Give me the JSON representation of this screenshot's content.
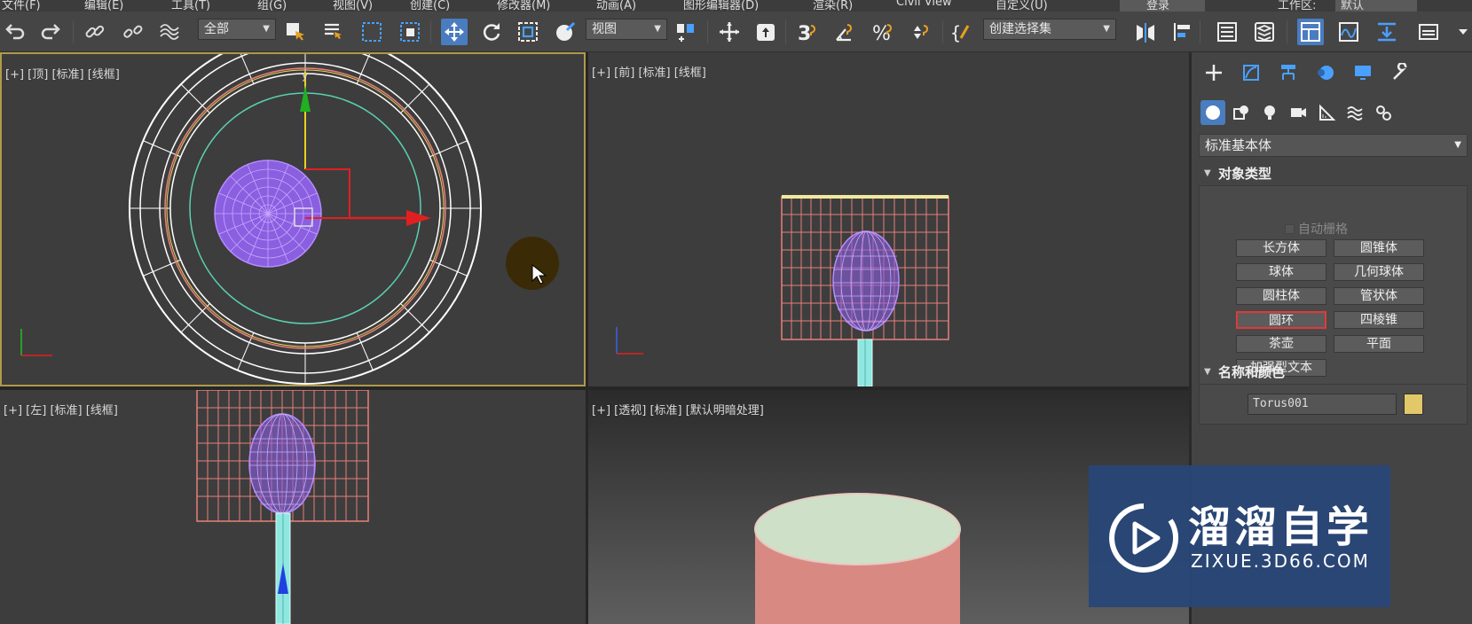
{
  "menubar": {
    "items": [
      "文件(F)",
      "编辑(E)",
      "工具(T)",
      "组(G)",
      "视图(V)",
      "创建(C)",
      "修改器(M)",
      "动画(A)",
      "图形编辑器(D)",
      "渲染(R)",
      "Civil View",
      "自定义(U)"
    ],
    "login_label": "登录",
    "workspace_label": "工作区:",
    "workspace_value": "默认"
  },
  "toolbar": {
    "selection_filter": "全部",
    "ref_coord": "视图",
    "named_selection": "创建选择集",
    "snap_label": "3",
    "icons": [
      "undo-icon",
      "redo-icon",
      "link-icon",
      "unlink-icon",
      "bind-spacewarp-icon",
      "select-object-icon",
      "select-by-name-icon",
      "rect-region-icon",
      "window-crossing-icon",
      "move-icon",
      "rotate-icon",
      "scale-icon",
      "placement-icon",
      "pivot-icon",
      "manipulate-icon",
      "snap-toggle-icon",
      "angle-snap-icon",
      "percent-snap-icon",
      "spinner-snap-icon",
      "edit-named-sets-icon",
      "mirror-icon",
      "align-icon",
      "layer-explorer-icon",
      "scene-explorer-icon",
      "ribbon-icon",
      "curve-editor-icon",
      "render-setup-icon",
      "rendered-frame-icon"
    ]
  },
  "viewports": {
    "top": {
      "label": "[+] [顶] [标准] [线框]"
    },
    "front": {
      "label": "[+] [前] [标准] [线框]"
    },
    "left": {
      "label": "[+] [左] [标准] [线框]"
    },
    "perspective": {
      "label": "[+] [透视] [标准] [默认明暗处理]"
    }
  },
  "command_panel": {
    "tabs": [
      "create-tab-icon",
      "modify-tab-icon",
      "hierarchy-tab-icon",
      "motion-tab-icon",
      "display-tab-icon",
      "utilities-tab-icon"
    ],
    "subcategories": [
      "geometry-icon",
      "shapes-icon",
      "lights-icon",
      "cameras-icon",
      "helpers-icon",
      "spacewarps-icon",
      "systems-icon"
    ],
    "category": "标准基本体",
    "object_type": {
      "title": "对象类型",
      "autogrid_label": "自动栅格",
      "buttons": [
        "长方体",
        "圆锥体",
        "球体",
        "几何球体",
        "圆柱体",
        "管状体",
        "圆环",
        "四棱锥",
        "茶壶",
        "平面",
        "加强型文本"
      ],
      "highlighted": "圆环"
    },
    "name_color": {
      "title": "名称和颜色",
      "name_value": "Torus001",
      "color": "#e3c869"
    }
  },
  "watermark": {
    "title": "溜溜自学",
    "url": "ZIXUE.3D66.COM"
  },
  "colors": {
    "accent": "#4a7cc0",
    "viewport_active_border": "#b09a4a",
    "highlight_border": "#e03a3a",
    "cylinder_wire": "#e8807a",
    "sphere_wire": "#9a6ae8",
    "torus_wire": "#ffffff",
    "gizmo_x": "#e02020",
    "gizmo_y": "#20c020"
  }
}
